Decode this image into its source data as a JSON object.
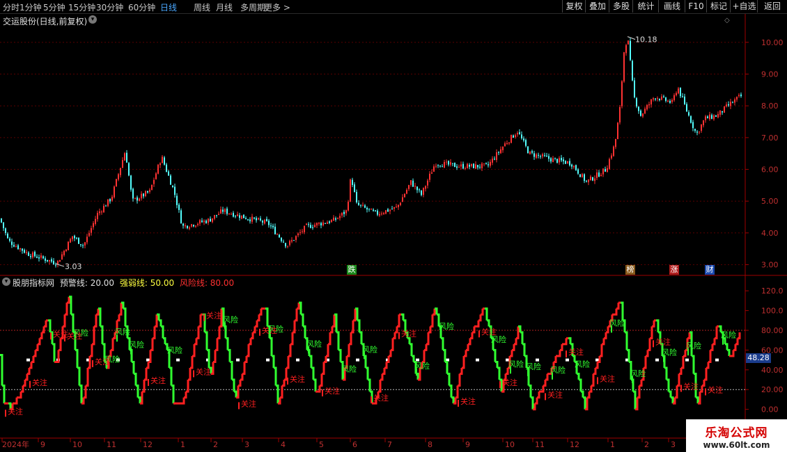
{
  "toolbar": {
    "periods": [
      "分时",
      "1分钟",
      "5分钟",
      "15分钟",
      "30分钟",
      "60分钟",
      "日线",
      "周线",
      "月线",
      "多周期",
      "更多 >"
    ],
    "active_period": "日线",
    "buttons": [
      "复权",
      "叠加",
      "多股",
      "统计",
      "画线",
      "F10",
      "标记",
      "+自选",
      "返回"
    ]
  },
  "main_chart": {
    "title": "交运股份(日线,前复权)",
    "y_ticks": [
      "10.00",
      "9.00",
      "8.00",
      "7.00",
      "6.00",
      "5.00",
      "4.00",
      "3.00"
    ],
    "y_range": [
      2.75,
      10.5
    ],
    "max_label": "10.18",
    "min_label": "3.03",
    "events": [
      {
        "label": "跌",
        "color": "#1c8a1c"
      },
      {
        "label": "榜",
        "color": "#8a5a1c"
      },
      {
        "label": "涨",
        "color": "#b01c1c"
      },
      {
        "label": "财",
        "color": "#1c4ab0"
      }
    ],
    "up_color": "#ff3232",
    "down_color": "#54ffff"
  },
  "indicator": {
    "name": "股朋指标网",
    "lines": [
      {
        "label": "预警线: 20.00",
        "color": "#e0e0e0"
      },
      {
        "label": "强弱线: 50.00",
        "color": "#ffff40"
      },
      {
        "label": "风险线: 80.00",
        "color": "#ff3030"
      }
    ],
    "y_ticks": [
      "120.0",
      "100.0",
      "80.00",
      "60.00",
      "40.00",
      "20.00",
      "0.00"
    ],
    "y_range": [
      -8,
      130
    ],
    "current_value": "48.28",
    "signal_risk": "风险",
    "signal_watch": "关注",
    "rise_color": "#ff2020",
    "fall_color": "#30ff30"
  },
  "x_axis": {
    "labels": [
      "2024年",
      "9",
      "10",
      "11",
      "12",
      "1",
      "2",
      "3",
      "4",
      "5",
      "6",
      "7",
      "8",
      "9",
      "10",
      "11",
      "12",
      "1",
      "2",
      "3"
    ]
  },
  "watermark": {
    "name": "乐淘公式网",
    "url": "www.60lt.com"
  }
}
